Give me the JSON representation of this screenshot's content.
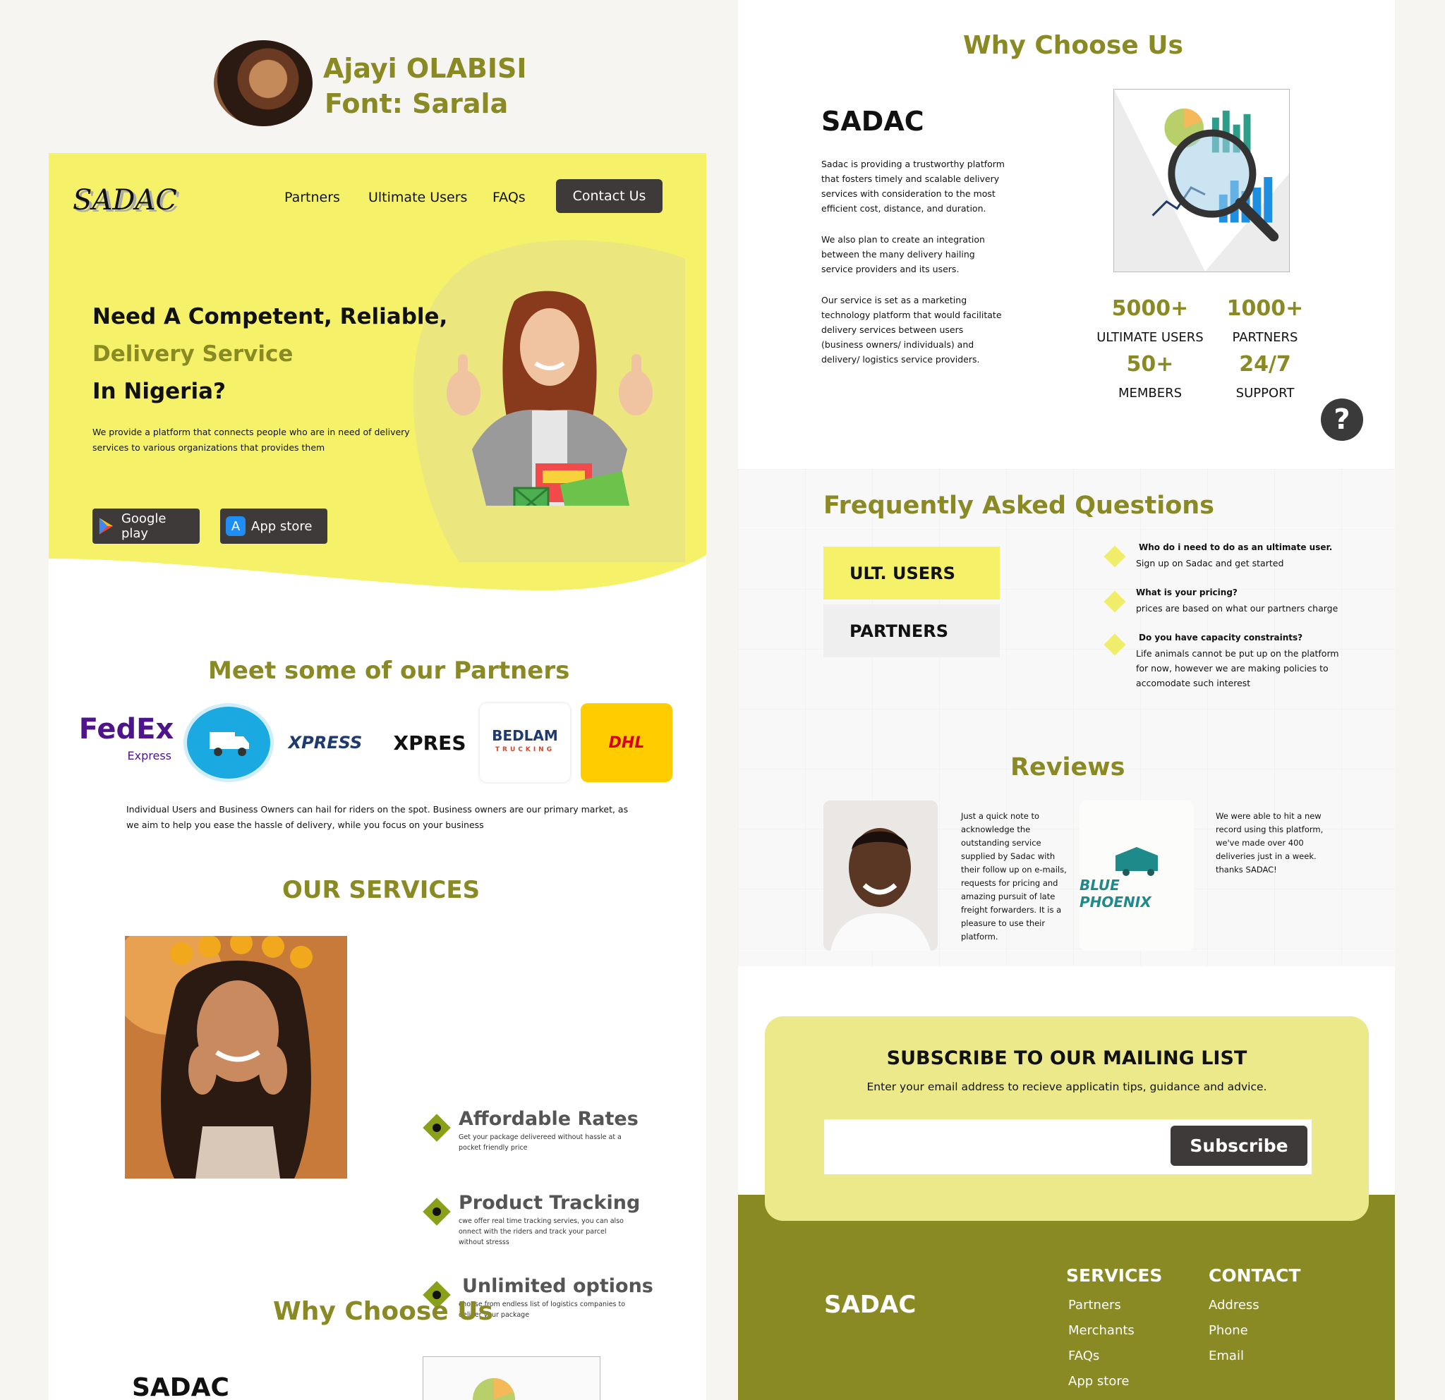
{
  "author": {
    "name": "Ajayi OLABISI",
    "font_label": "Font: Sarala"
  },
  "colors": {
    "olive": "#8a8a24",
    "hero_yellow": "#f5f26a",
    "dark_button": "#3e3a3a",
    "pale_yellow": "#ebe98a"
  },
  "header": {
    "brand": "SADAC",
    "nav": [
      "Partners",
      "Ultimate Users",
      "FAQs"
    ],
    "contact_button": "Contact Us"
  },
  "hero": {
    "line1": "Need A Competent, Reliable,",
    "line2": "Delivery Service",
    "line3": "In Nigeria?",
    "description": "We provide a platform that connects people who are in need of delivery services to various organizations that provides them",
    "google_play": "Google play",
    "app_store": "App store"
  },
  "partners": {
    "title": "Meet some of our Partners",
    "logos": [
      "FedEx",
      "Express",
      "XPRESS",
      "XPRES",
      "BEDLAM",
      "TRUCKING",
      "DHL"
    ],
    "description": "Individual Users and Business Owners can hail for riders on the spot. Business owners are our primary market, as we aim to help you ease the hassle of delivery, while you focus on your business"
  },
  "services": {
    "title": "OUR SERVICES",
    "items": [
      {
        "title": "Affordable Rates",
        "desc": "Get your package delivereed without hassle at a pocket friendly price"
      },
      {
        "title": "Product Tracking",
        "desc": "cwe offer real time tracking servies, you can also onnect with the riders and  track your parcel without stresss"
      },
      {
        "title": "Unlimited options",
        "desc": "choose from endless list of logistics companies to deliver your package"
      }
    ]
  },
  "why": {
    "title": "Why Choose Us",
    "brand": "SADAC",
    "paragraphs": [
      "Sadac is providing a trustworthy platform that fosters timely and scalable delivery services with consideration to the most efficient cost, distance, and duration.",
      "We also plan to create an integration between the many delivery hailing service providers and its users.",
      "Our service is set as a marketing technology platform that would facilitate delivery services between users (business owners/ individuals) and delivery/ logistics service providers."
    ],
    "stats": [
      {
        "value": "5000+",
        "label": "ULTIMATE USERS"
      },
      {
        "value": "1000+",
        "label": "PARTNERS"
      },
      {
        "value": "50+",
        "label": "MEMBERS"
      },
      {
        "value": "24/7",
        "label": "SUPPORT"
      }
    ],
    "help_glyph": "?"
  },
  "faq": {
    "title": "Frequently Asked Questions",
    "tabs": [
      "ULT. USERS",
      "PARTNERS"
    ],
    "items": [
      {
        "q": "Who do i need to do as an ultimate user.",
        "a": "Sign up on Sadac and get started"
      },
      {
        "q": "What is your pricing?",
        "a": "prices are based on what our partners charge"
      },
      {
        "q": "Do you have capacity constraints?",
        "a": "Life animals cannot be put up on the platform for now, however we are  making policies to accomodate such interest"
      }
    ]
  },
  "reviews": {
    "title": "Reviews",
    "text1": "Just a quick note to acknowledge the outstanding service supplied by Sadac with their follow up on e-mails, requests for pricing and amazing pursuit of late freight forwarders. It is a pleasure to use their platform.",
    "logo_name": "BLUE PHOENIX",
    "text2": "We were able to hit a new record using this platform, we've made over 400 deliveries just in a week. thanks SADAC!"
  },
  "subscribe": {
    "title": "SUBSCRIBE TO OUR MAILING LIST",
    "desc": "Enter your email address to recieve applicatin tips, guidance and advice.",
    "button": "Subscribe"
  },
  "footer": {
    "brand": "SADAC",
    "services_head": "SERVICES",
    "services": [
      "Partners",
      "Merchants",
      "FAQs",
      "App store"
    ],
    "contact_head": "CONTACT",
    "contact": [
      "Address",
      "Phone",
      "Email"
    ]
  },
  "bottom_preview": {
    "title": "Why Choose Us",
    "brand": "SADAC"
  }
}
